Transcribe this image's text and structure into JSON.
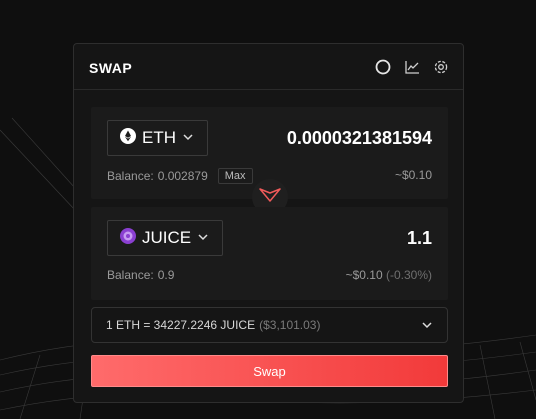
{
  "header": {
    "title": "SWAP",
    "icons": [
      "refresh-icon",
      "chart-icon",
      "settings-icon"
    ]
  },
  "from": {
    "token": "ETH",
    "amount": "0.0000321381594",
    "balance_label": "Balance:",
    "balance_value": "0.002879",
    "max_label": "Max",
    "usd": "~$0.10"
  },
  "to": {
    "token": "JUICE",
    "amount": "1.1",
    "balance_label": "Balance:",
    "balance_value": "0.9",
    "usd": "~$0.10",
    "impact": "(-0.30%)"
  },
  "rate": {
    "text": "1 ETH = 34227.2246 JUICE",
    "usd": "($3,101.03)"
  },
  "swap_button": {
    "label": "Swap"
  },
  "colors": {
    "accent": "#f23a3a",
    "panel": "#151515",
    "card": "#1b1b1b"
  }
}
